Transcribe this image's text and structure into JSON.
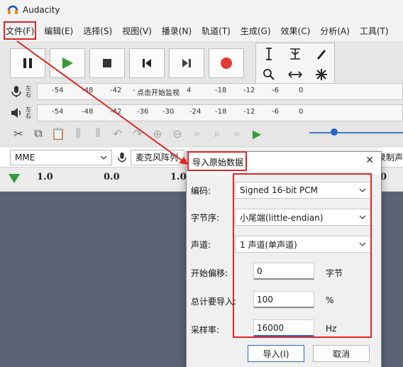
{
  "window": {
    "title": "Audacity"
  },
  "menu": {
    "items": [
      "文件(F)",
      "编辑(E)",
      "选择(S)",
      "视图(V)",
      "播录(N)",
      "轨道(T)",
      "生成(G)",
      "效果(C)",
      "分析(A)",
      "工具(T)"
    ]
  },
  "meters": {
    "record": {
      "ticks": [
        "-54",
        "-48",
        "-42",
        "-",
        "4",
        "-18",
        "-12",
        "-6",
        "0"
      ],
      "hint": "点击开始监视",
      "lr": [
        "左",
        "右"
      ]
    },
    "playback": {
      "ticks": [
        "-54",
        "-48",
        "-42",
        "-36",
        "-30",
        "-24",
        "-18",
        "-12",
        "-6",
        "0"
      ],
      "lr": [
        "左",
        "右"
      ]
    }
  },
  "devices": {
    "host": "MME",
    "mic": "麦克风阵列",
    "right_label": "录制声"
  },
  "timeline": {
    "marks": [
      "1.0",
      "0.0",
      "1.0",
      "0"
    ]
  },
  "dialog": {
    "title": "导入原始数据",
    "encoding_label": "编码:",
    "encoding_value": "Signed 16-bit PCM",
    "byteorder_label": "字节序:",
    "byteorder_value": "小尾端(little-endian)",
    "channels_label": "声道:",
    "channels_value": "1 声道(单声道)",
    "offset_label": "开始偏移:",
    "offset_value": "0",
    "offset_unit": "字节",
    "amount_label": "总计要导入:",
    "amount_value": "100",
    "amount_unit": "%",
    "rate_label": "采样率:",
    "rate_value": "16000",
    "rate_unit": "Hz",
    "import_button": "导入(I)",
    "cancel_button": "取消"
  },
  "colors": {
    "annotation_red": "#e02424",
    "play_green": "#3a9a3a",
    "record_red": "#e53935",
    "track_bg": "#5b6476"
  }
}
